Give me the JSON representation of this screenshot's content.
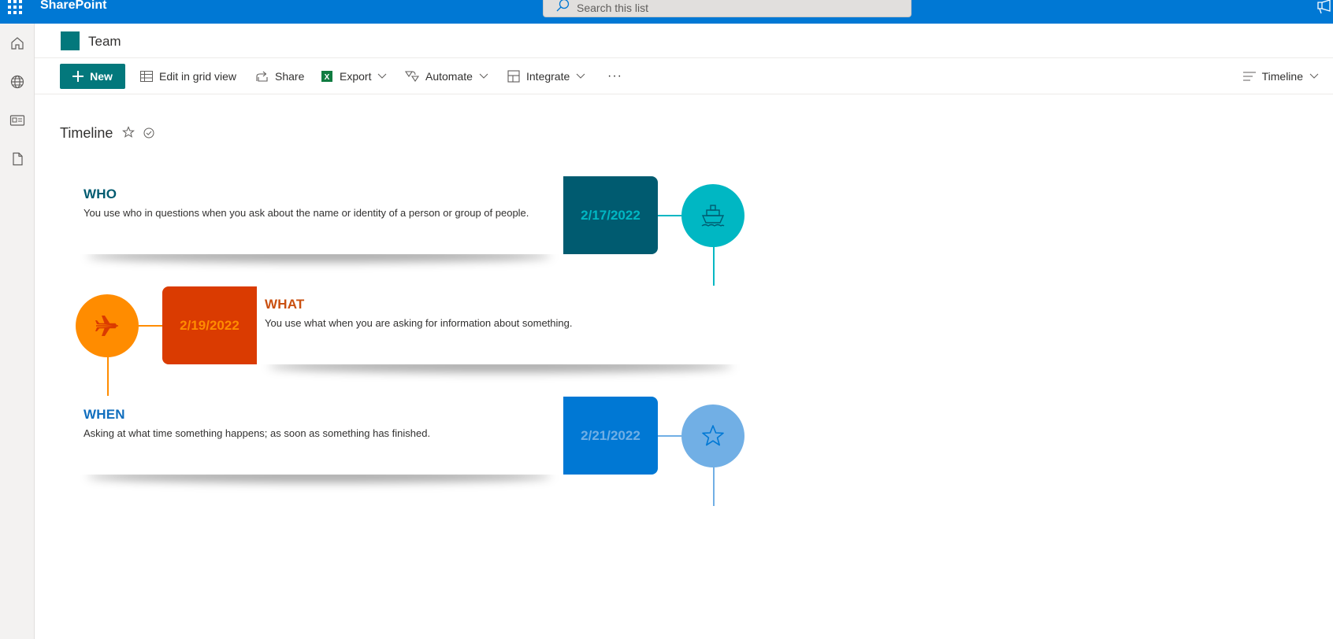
{
  "suite": {
    "brand": "SharePoint",
    "search_placeholder": "Search this list"
  },
  "rail": {
    "items": [
      "home-icon",
      "globe-icon",
      "news-icon",
      "document-icon"
    ]
  },
  "site": {
    "title": "Team"
  },
  "commands": {
    "new_label": "New",
    "edit_grid": "Edit in grid view",
    "share": "Share",
    "export": "Export",
    "automate": "Automate",
    "integrate": "Integrate",
    "more": "···",
    "view_name": "Timeline"
  },
  "view": {
    "title": "Timeline"
  },
  "timeline": [
    {
      "title": "WHO",
      "description": "You use who in questions when you ask about the name or identity of a person or group of people.",
      "date": "2/17/2022",
      "icon": "ship-icon",
      "title_color": "#005b70",
      "box_color": "#005b70",
      "date_color": "#00b7c3",
      "circle_color": "#00b7c3",
      "icon_color": "#005b70"
    },
    {
      "title": "WHAT",
      "description": "You use what when you are asking for information about something.",
      "date": "2/19/2022",
      "icon": "airplane-icon",
      "title_color": "#ca5010",
      "box_color": "#da3b01",
      "date_color": "#ff8c00",
      "circle_color": "#ff8c00",
      "icon_color": "#da3b01"
    },
    {
      "title": "WHEN",
      "description": "Asking at what time something happens; as soon as something has finished.",
      "date": "2/21/2022",
      "icon": "star-icon",
      "title_color": "#106ebe",
      "box_color": "#0078d4",
      "date_color": "#71afe5",
      "circle_color": "#71afe5",
      "icon_color": "#0078d4"
    }
  ]
}
